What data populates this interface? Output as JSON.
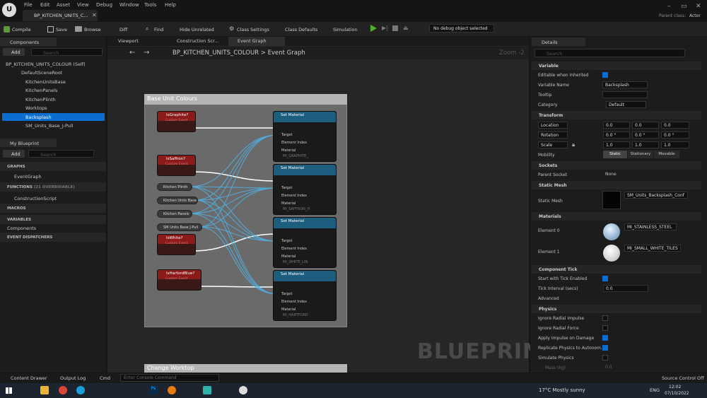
{
  "app": {
    "logo": "U",
    "menu": [
      "File",
      "Edit",
      "Asset",
      "View",
      "Debug",
      "Window",
      "Tools",
      "Help"
    ],
    "tab_title": "BP_KITCHEN_UNITS_C...",
    "parent_class_label": "Parent class:",
    "parent_class": "Actor"
  },
  "toolbar": {
    "compile": "Compile",
    "save": "Save",
    "browse": "Browse",
    "diff": "Diff",
    "find": "Find",
    "hide_unrelated": "Hide Unrelated",
    "class_settings": "Class Settings",
    "class_defaults": "Class Defaults",
    "simulation": "Simulation",
    "debug_object": "No debug object selected"
  },
  "components": {
    "title": "Components",
    "add": "Add",
    "search_placeholder": "Search",
    "items": [
      "BP_KITCHEN_UNITS_COLOUR (Self)",
      "DefaultSceneRoot",
      "KitchenUnitsBase",
      "KitchenPanels",
      "KitchenPlinth",
      "Worktops",
      "Backsplash",
      "SM_Units_Base_J-Pull"
    ]
  },
  "myblueprint": {
    "title": "My Blueprint",
    "add": "Add",
    "search_placeholder": "Search",
    "graphs": "GRAPHS",
    "event_graph": "EventGraph",
    "functions": "FUNCTIONS",
    "functions_count": "(21 OVERRIDABLE)",
    "construction": "ConstructionScript",
    "macros": "MACROS",
    "variables": "VARIABLES",
    "components": "Components",
    "dispatchers": "EVENT DISPATCHERS"
  },
  "graph": {
    "tabs": [
      "Viewport",
      "Construction Scr...",
      "Event Graph"
    ],
    "breadcrumb_root": "BP_KITCHEN_UNITS_COLOUR",
    "breadcrumb_sep": ">",
    "breadcrumb_leaf": "Event Graph",
    "zoom": "Zoom -2",
    "comment": "Base Unit Colours",
    "comment2": "Change Worktop",
    "watermark": "BLUEPRINT",
    "events": [
      {
        "name": "IsGraphite?",
        "sub": "Custom Event"
      },
      {
        "name": "IsSaffron?",
        "sub": "Custom Event"
      },
      {
        "name": "IsWhite?",
        "sub": "Custom Event"
      },
      {
        "name": "IsHarfordBlue?",
        "sub": "Custom Event"
      }
    ],
    "vars": [
      "Kitchen Plinth",
      "Kitchen Units Base",
      "Kitchen Panels",
      "SM Units Base J-Pull"
    ],
    "set_material": {
      "title": "Set Material",
      "sub": "Target is Primitive Component",
      "target": "Target",
      "element_index": "Element Index",
      "index_value": "0",
      "material": "Material"
    },
    "materials": [
      "MI_GRAPHITE_",
      "MI_SAFFRON_H",
      "MI_WHITE_LIN",
      "MI_HARTFORD"
    ]
  },
  "details": {
    "title": "Details",
    "search_placeholder": "Search",
    "variable": {
      "header": "Variable",
      "editable": "Editable when Inherited",
      "name_label": "Variable Name",
      "name_value": "Backsplash",
      "tooltip": "Tooltip",
      "category": "Category",
      "category_value": "Default"
    },
    "transform": {
      "header": "Transform",
      "location": "Location",
      "rotation": "Rotation",
      "scale": "Scale",
      "loc": [
        "0.0",
        "0.0",
        "0.0"
      ],
      "rot": [
        "0.0 °",
        "0.0 °",
        "0.0 °"
      ],
      "scl": [
        "1.0",
        "1.0",
        "1.0"
      ],
      "mobility": "Mobility",
      "mob_opts": [
        "Static",
        "Stationary",
        "Movable"
      ]
    },
    "sockets": {
      "header": "Sockets",
      "parent": "Parent Socket",
      "parent_value": "None"
    },
    "static_mesh": {
      "header": "Static Mesh",
      "label": "Static Mesh",
      "value": "SM_Units_Backsplash_Conf"
    },
    "materials": {
      "header": "Materials",
      "e0": "Element 0",
      "e0v": "MI_STAINLESS_STEEL",
      "e1": "Element 1",
      "e1v": "MI_SMALL_WHITE_TILES"
    },
    "tick": {
      "header": "Component Tick",
      "start": "Start with Tick Enabled",
      "interval": "Tick Interval (secs)",
      "interval_value": "0.0",
      "advanced": "Advanced"
    },
    "physics": {
      "header": "Physics",
      "items": [
        "Ignore Radial Impulse",
        "Ignore Radial Force",
        "Apply Impulse on Damage",
        "Replicate Physics to Autonom...",
        "Simulate Physics"
      ],
      "mass": "Mass (kg)",
      "mass_value": "0.0"
    }
  },
  "bottom": {
    "content_drawer": "Content Drawer",
    "output_log": "Output Log",
    "cmd": "Cmd",
    "console_placeholder": "Enter Console Command",
    "source_control": "Source Control Off"
  },
  "taskbar": {
    "weather": "17°C  Mostly sunny",
    "lang": "ENG",
    "time": "12:02",
    "date": "07/10/2022"
  }
}
